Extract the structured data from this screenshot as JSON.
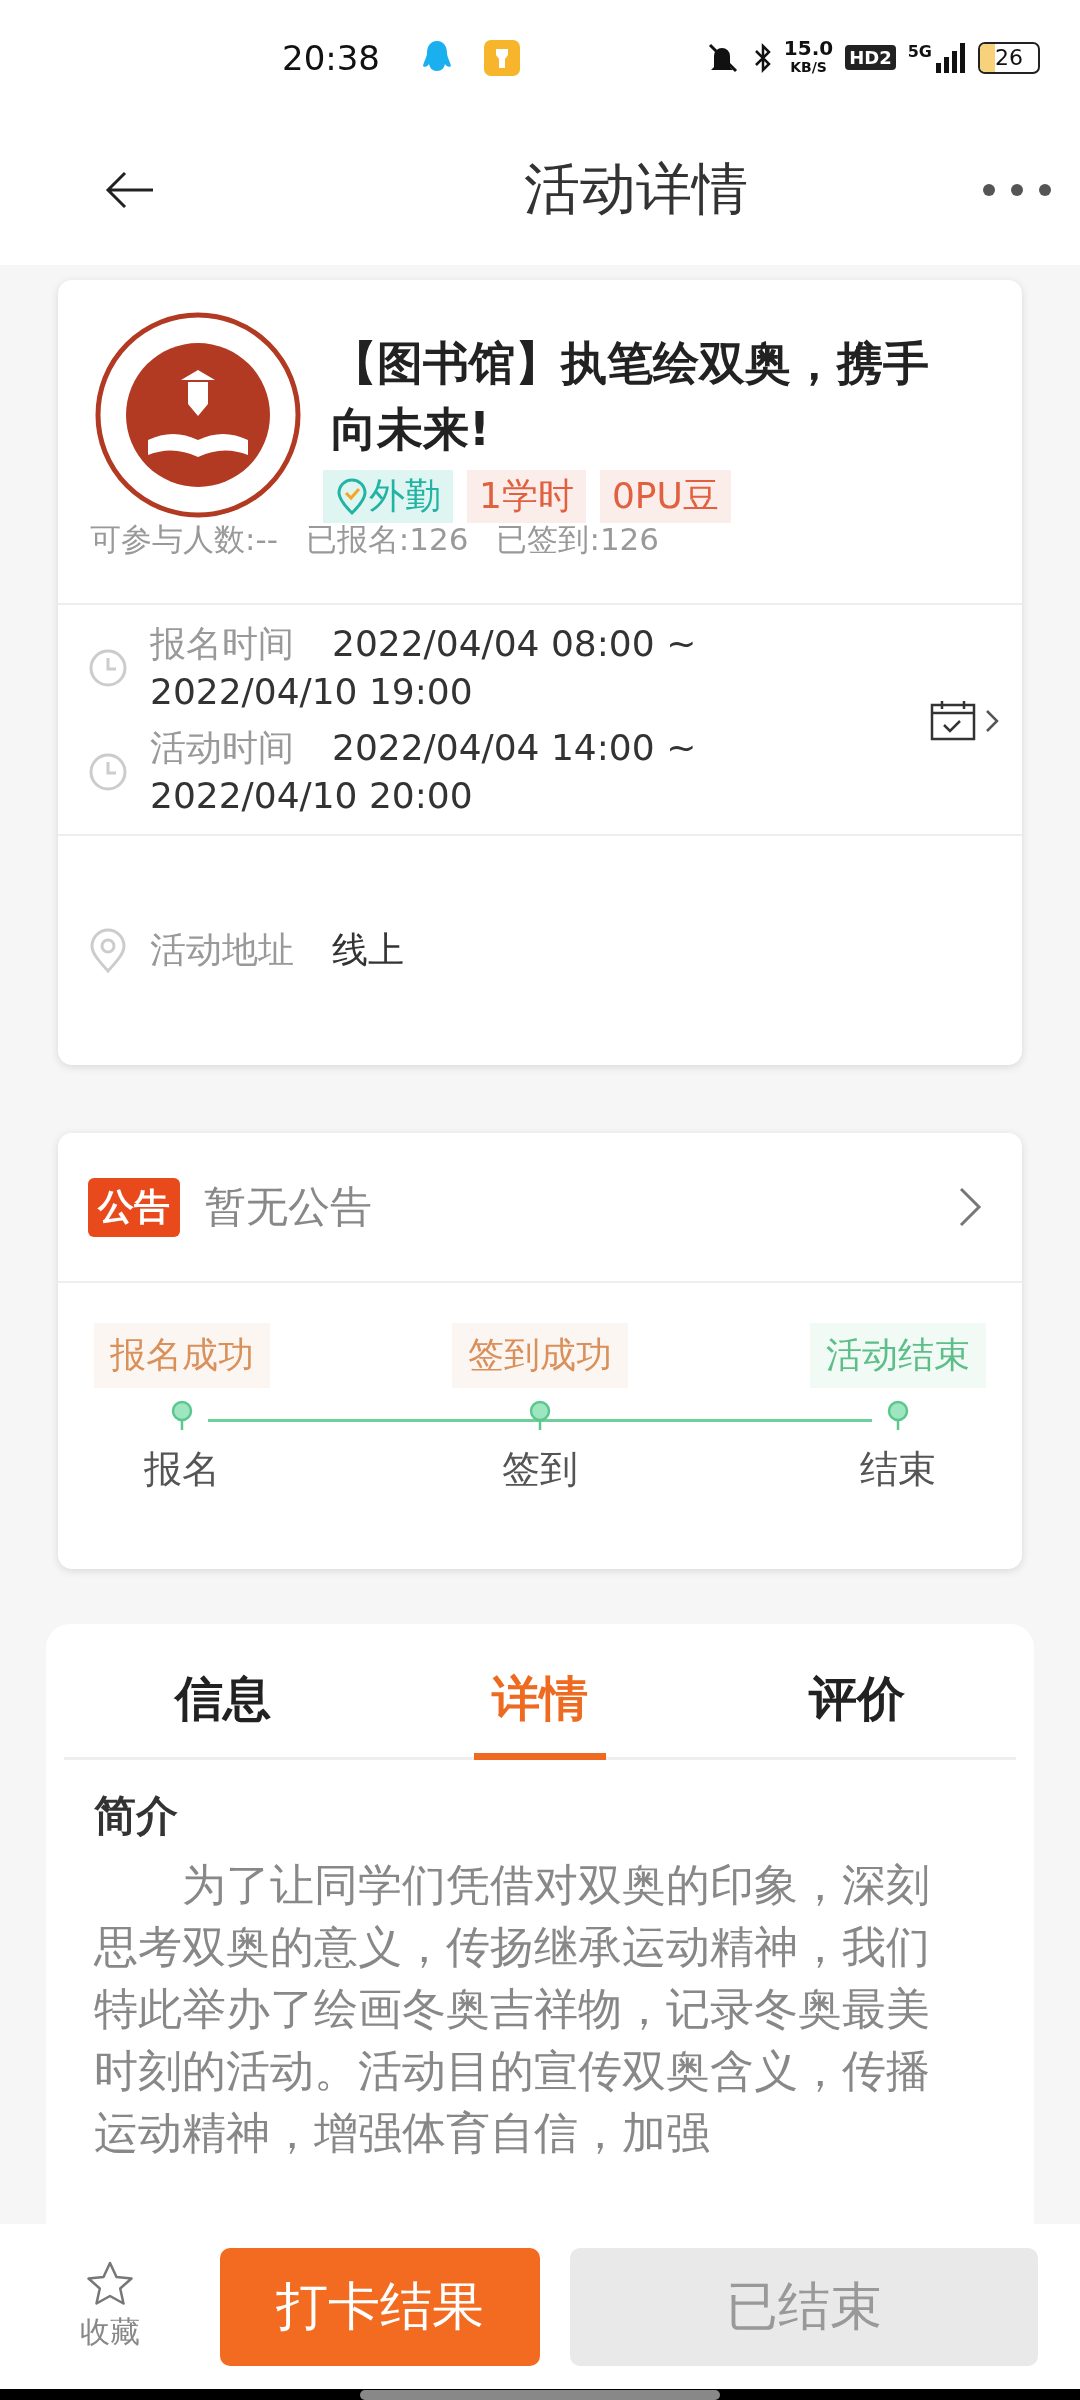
{
  "status_bar": {
    "time": "20:38",
    "net_speed": "15.0",
    "net_unit": "KB/S",
    "hd": "HD2",
    "network": "5G",
    "battery": "26"
  },
  "header": {
    "title": "活动详情"
  },
  "activity": {
    "title": "【图书馆】执笔绘双奥，携手向未来!",
    "tags": [
      {
        "kind": "attendance",
        "label": "外勤"
      },
      {
        "kind": "plain",
        "label": "1学时"
      },
      {
        "kind": "plain",
        "label": "0PU豆"
      }
    ],
    "stats": [
      "可参与人数:--",
      "已报名:126",
      "已签到:126"
    ],
    "times": [
      {
        "label": "报名时间",
        "value": "2022/04/04 08:00 ~ 2022/04/10 19:00"
      },
      {
        "label": "活动时间",
        "value": "2022/04/04 14:00 ~ 2022/04/10 20:00"
      }
    ],
    "address": {
      "label": "活动地址",
      "value": "线上"
    }
  },
  "notice": {
    "badge": "公告",
    "text": "暂无公告"
  },
  "progress": [
    {
      "status": "报名成功",
      "step": "报名",
      "color": "#d9905a"
    },
    {
      "status": "签到成功",
      "step": "签到",
      "color": "#d9905a"
    },
    {
      "status": "活动结束",
      "step": "结束",
      "color": "#5cbf8a"
    }
  ],
  "tabs": [
    {
      "label": "信息",
      "selected": false
    },
    {
      "label": "详情",
      "selected": true
    },
    {
      "label": "评价",
      "selected": false
    }
  ],
  "intro": {
    "heading": "简介",
    "text": "为了让同学们凭借对双奥的印象，深刻思考双奥的意义，传扬继承运动精神，我们特此举办了绘画冬奥吉祥物，记录冬奥最美时刻的活动。活动目的宣传双奥含义，传播运动精神，增强体育自信，加强"
  },
  "bottom": {
    "favorite": "收藏",
    "primary": "打卡结果",
    "secondary": "已结束"
  }
}
